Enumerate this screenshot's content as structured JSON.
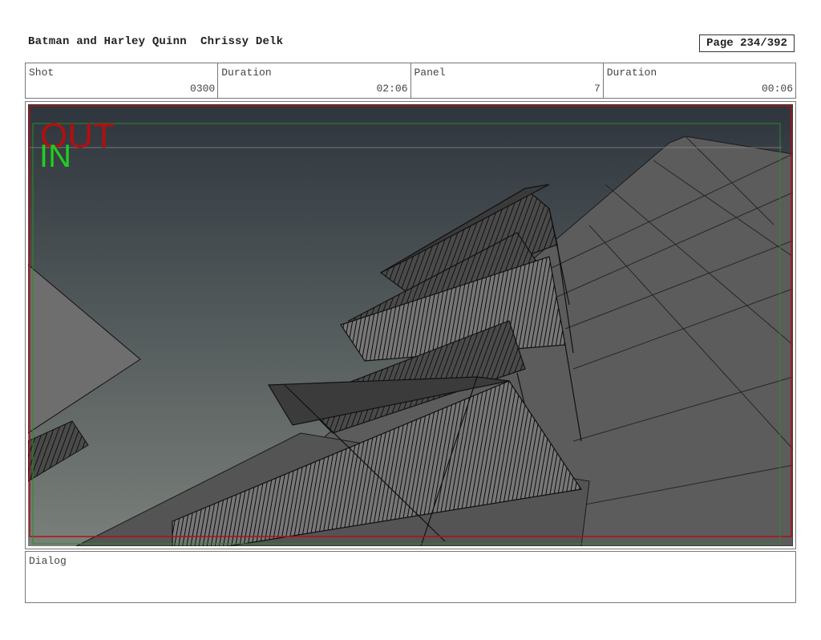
{
  "header": {
    "project": "Batman and Harley Quinn",
    "artist": "Chrissy Delk",
    "page": "Page 234/392"
  },
  "info": {
    "shot_label": "Shot",
    "shot_value": "0300",
    "shot_duration_label": "Duration",
    "shot_duration_value": "02:06",
    "panel_label": "Panel",
    "panel_value": "7",
    "panel_duration_label": "Duration",
    "panel_duration_value": "00:06"
  },
  "frame": {
    "marker_out": "OUT",
    "marker_in": "IN",
    "colors": {
      "sky_top": "#2e353d",
      "sky_bottom": "#79807a",
      "wall": "#5c5c5c",
      "outline": "#111111",
      "marker_out": "#b01010",
      "marker_in": "#22cc22",
      "safe_red": "#b01010",
      "safe_green": "#2a8a2a"
    }
  },
  "dialog": {
    "label": "Dialog"
  }
}
